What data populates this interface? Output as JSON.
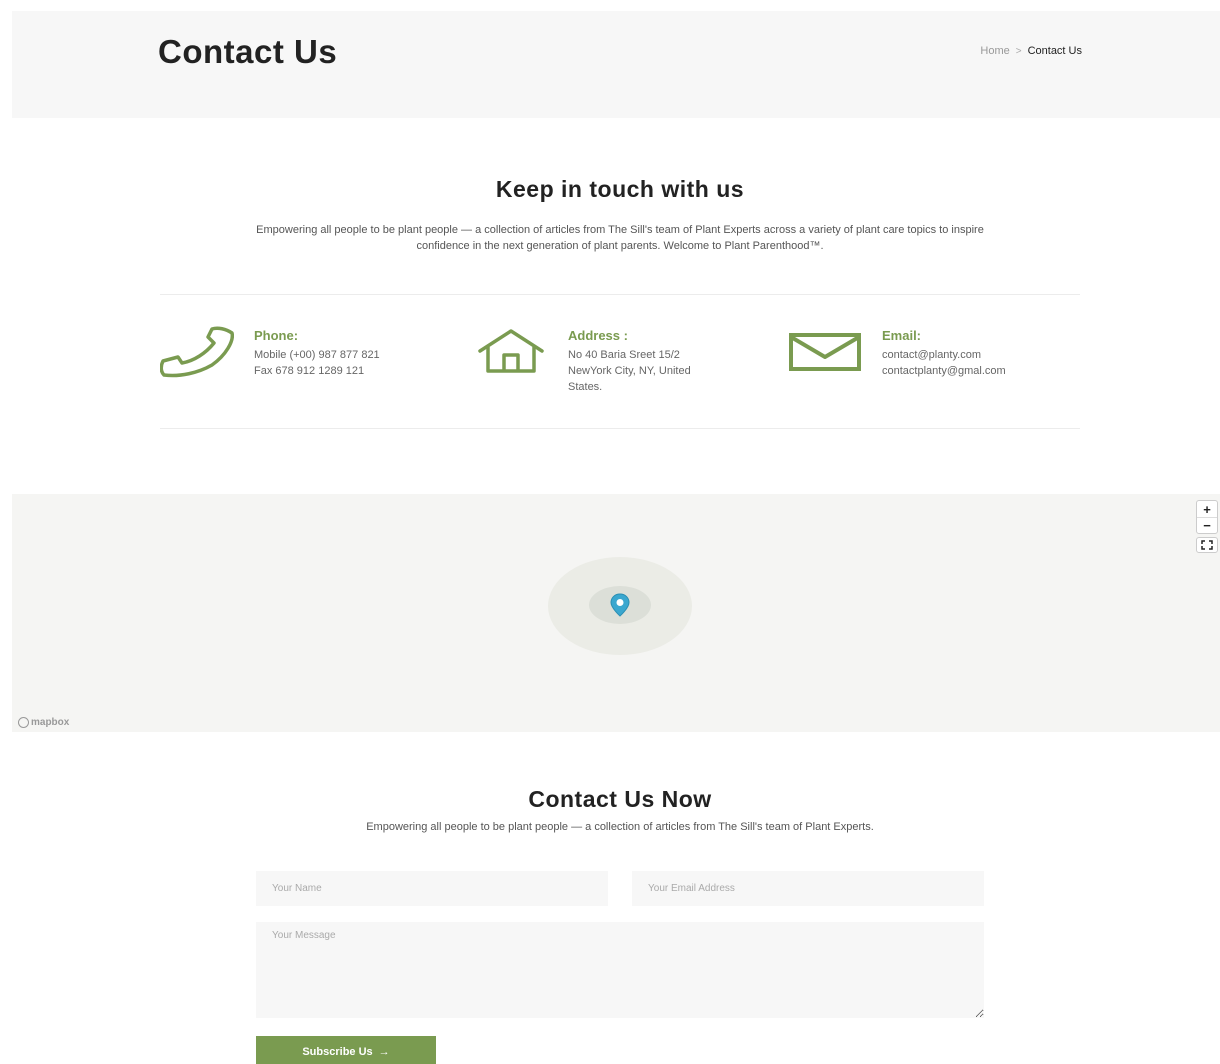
{
  "banner": {
    "title": "Contact Us",
    "breadcrumb": {
      "home": "Home",
      "separator": ">",
      "current": "Contact Us"
    }
  },
  "touch": {
    "title": "Keep in touch with us",
    "description": "Empowering all people to be plant people — a collection of articles from The Sill's team of Plant Experts across a variety of plant care topics to inspire confidence in the next generation of plant parents. Welcome to Plant Parenthood™."
  },
  "info": {
    "phone": {
      "label": "Phone:",
      "lines": [
        "Mobile (+00) 987 877 821",
        "Fax 678 912 1289 121"
      ],
      "icon": "phone-icon"
    },
    "address": {
      "label": "Address :",
      "lines": [
        "No 40 Baria Sreet 15/2",
        "NewYork City, NY, United",
        "States."
      ],
      "icon": "home-icon"
    },
    "email": {
      "label": "Email:",
      "lines": [
        "contact@planty.com",
        "contactplanty@gmal.com"
      ],
      "icon": "envelope-icon"
    }
  },
  "map": {
    "zoom_in": "+",
    "zoom_out": "−",
    "attribution": "mapbox"
  },
  "contact": {
    "title": "Contact Us Now",
    "description": "Empowering all people to be plant people — a collection of articles from The Sill's team of Plant Experts.",
    "name_placeholder": "Your Name",
    "email_placeholder": "Your Email Address",
    "message_placeholder": "Your Message",
    "submit_label": "Subscribe Us",
    "submit_arrow": "→"
  },
  "colors": {
    "accent": "#7a9b50",
    "banner_bg": "#f7f7f7",
    "pin": "#3aa7cf"
  }
}
